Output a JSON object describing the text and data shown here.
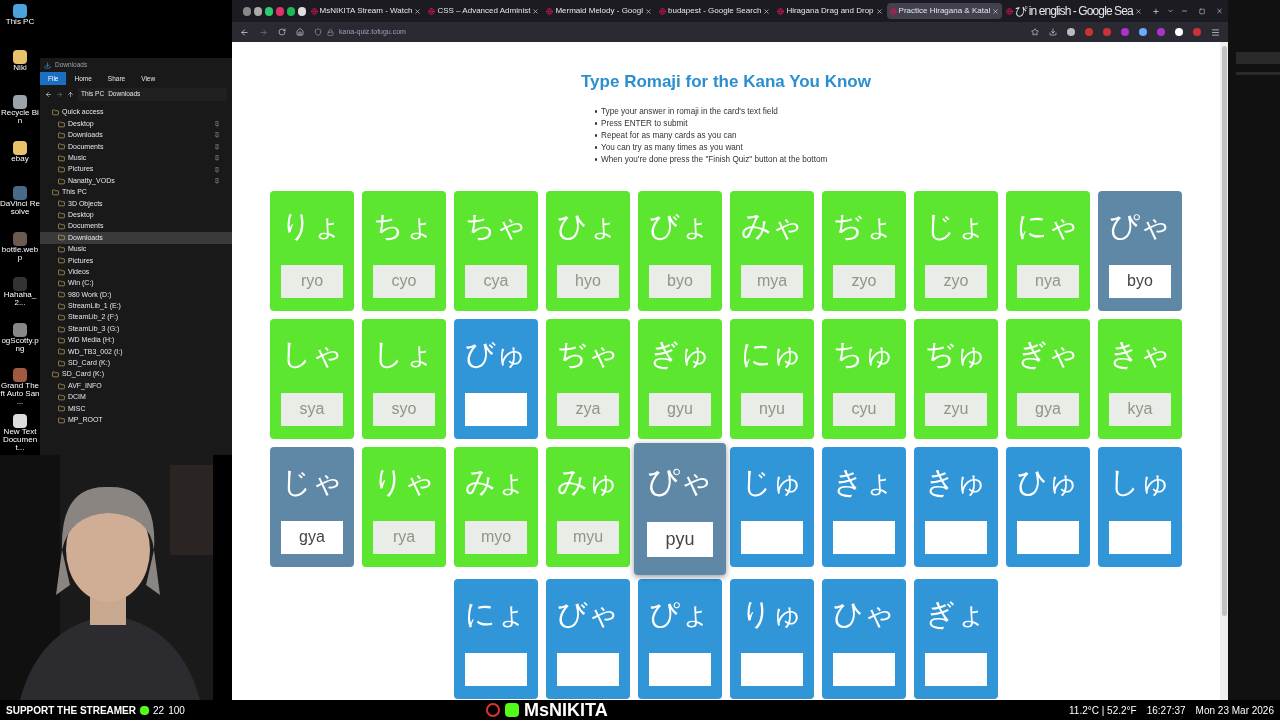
{
  "desktop": {
    "icons": [
      {
        "label": "This PC"
      },
      {
        "label": "Niki"
      },
      {
        "label": "Recycle Bin"
      },
      {
        "label": "ebay"
      },
      {
        "label": "DaVinci Resolve"
      },
      {
        "label": "bottle.webp"
      },
      {
        "label": "Hahaha_2..."
      },
      {
        "label": "ogScotty.png"
      },
      {
        "label": "Grand Theft Auto San ..."
      },
      {
        "label": "New Text Document..."
      }
    ]
  },
  "explorer": {
    "title": "Downloads",
    "ribbon_tabs": [
      {
        "label": "File",
        "selected": true
      },
      {
        "label": "Home",
        "selected": false
      },
      {
        "label": "Share",
        "selected": false
      },
      {
        "label": "View",
        "selected": false
      }
    ],
    "breadcrumb": [
      "This PC",
      "Downloads"
    ],
    "tree": [
      {
        "label": "Quick access",
        "selected": false,
        "children": [
          {
            "label": "Desktop",
            "selected": false,
            "pinned": true
          },
          {
            "label": "Downloads",
            "selected": false,
            "pinned": true
          },
          {
            "label": "Documents",
            "selected": false,
            "pinned": true
          },
          {
            "label": "Music",
            "selected": false,
            "pinned": true
          },
          {
            "label": "Pictures",
            "selected": false,
            "pinned": true
          },
          {
            "label": "Nanatty_VODs",
            "selected": false,
            "pinned": true
          }
        ]
      },
      {
        "label": "This PC",
        "selected": false,
        "children": [
          {
            "label": "3D Objects",
            "selected": false,
            "pinned": false
          },
          {
            "label": "Desktop",
            "selected": false,
            "pinned": false
          },
          {
            "label": "Documents",
            "selected": false,
            "pinned": false
          },
          {
            "label": "Downloads",
            "selected": true,
            "pinned": false
          },
          {
            "label": "Music",
            "selected": false,
            "pinned": false
          },
          {
            "label": "Pictures",
            "selected": false,
            "pinned": false
          },
          {
            "label": "Videos",
            "selected": false,
            "pinned": false
          },
          {
            "label": "Win (C:)",
            "selected": false,
            "pinned": false
          },
          {
            "label": "980 Work (D:)",
            "selected": false,
            "pinned": false
          },
          {
            "label": "StreamLib_1 (E:)",
            "selected": false,
            "pinned": false
          },
          {
            "label": "SteamLib_2 (F:)",
            "selected": false,
            "pinned": false
          },
          {
            "label": "SteamLib_3 (G:)",
            "selected": false,
            "pinned": false
          },
          {
            "label": "WD Media (H:)",
            "selected": false,
            "pinned": false
          },
          {
            "label": "WD_TB3_002 (I:)",
            "selected": false,
            "pinned": false
          },
          {
            "label": "SD_Card (K:)",
            "selected": false,
            "pinned": false
          }
        ]
      },
      {
        "label": "SD_Card (K:)",
        "selected": false,
        "children": [
          {
            "label": "AVF_INFO",
            "selected": false,
            "pinned": false
          },
          {
            "label": "DCIM",
            "selected": false,
            "pinned": false
          },
          {
            "label": "MISC",
            "selected": false,
            "pinned": false
          },
          {
            "label": "MP_ROOT",
            "selected": false,
            "pinned": false
          }
        ]
      }
    ]
  },
  "browser": {
    "tabs": [
      {
        "label": "MsNIKITA Stream - Watch",
        "selected": false
      },
      {
        "label": "CSS – Advanced Administ",
        "selected": false
      },
      {
        "label": "Mermaid Melody - Googl",
        "selected": false
      },
      {
        "label": "budapest - Google Search",
        "selected": false
      },
      {
        "label": "Hiragana Drag and Drop",
        "selected": false
      },
      {
        "label": "Practice Hiragana & Katal",
        "selected": true
      },
      {
        "label": "ぴ in english - Google Sea",
        "selected": false
      }
    ],
    "url": "kana-quiz.tofugu.com"
  },
  "page": {
    "title": "Type Romaji for the Kana You Know",
    "instructions": [
      "Type your answer in romaji in the card's text field",
      "Press ENTER to submit",
      "Repeat for as many cards as you can",
      "You can try as many times as you want",
      "When you're done press the \"Finish Quiz\" button at the bottom"
    ],
    "cards": [
      {
        "kana": "りょ",
        "kind": "correct",
        "answer": "ryo",
        "focused": false
      },
      {
        "kana": "ちょ",
        "kind": "correct",
        "answer": "cyo",
        "focused": false
      },
      {
        "kana": "ちゃ",
        "kind": "correct",
        "answer": "cya",
        "focused": false
      },
      {
        "kana": "ひょ",
        "kind": "correct",
        "answer": "hyo",
        "focused": false
      },
      {
        "kana": "びょ",
        "kind": "correct",
        "answer": "byo",
        "focused": false
      },
      {
        "kana": "みゃ",
        "kind": "correct",
        "answer": "mya",
        "focused": false
      },
      {
        "kana": "ぢょ",
        "kind": "correct",
        "answer": "zyo",
        "focused": false
      },
      {
        "kana": "じょ",
        "kind": "correct",
        "answer": "zyo",
        "focused": false
      },
      {
        "kana": "にゃ",
        "kind": "correct",
        "answer": "nya",
        "focused": false
      },
      {
        "kana": "ぴゃ",
        "kind": "wrong",
        "answer": "byo",
        "focused": false
      },
      {
        "kana": "しゃ",
        "kind": "correct",
        "answer": "sya",
        "focused": false
      },
      {
        "kana": "しょ",
        "kind": "correct",
        "answer": "syo",
        "focused": false
      },
      {
        "kana": "びゅ",
        "kind": "open",
        "focused": false
      },
      {
        "kana": "ぢゃ",
        "kind": "correct",
        "answer": "zya",
        "focused": false
      },
      {
        "kana": "ぎゅ",
        "kind": "correct",
        "answer": "gyu",
        "focused": false
      },
      {
        "kana": "にゅ",
        "kind": "correct",
        "answer": "nyu",
        "focused": false
      },
      {
        "kana": "ちゅ",
        "kind": "correct",
        "answer": "cyu",
        "focused": false
      },
      {
        "kana": "ぢゅ",
        "kind": "correct",
        "answer": "zyu",
        "focused": false
      },
      {
        "kana": "ぎゃ",
        "kind": "correct",
        "answer": "gya",
        "focused": false
      },
      {
        "kana": "きゃ",
        "kind": "correct",
        "answer": "kya",
        "focused": false
      },
      {
        "kana": "じゃ",
        "kind": "wrong",
        "answer": "gya",
        "focused": false
      },
      {
        "kana": "りゃ",
        "kind": "correct",
        "answer": "rya",
        "focused": false
      },
      {
        "kana": "みょ",
        "kind": "correct",
        "answer": "myo",
        "focused": false
      },
      {
        "kana": "みゅ",
        "kind": "correct",
        "answer": "myu",
        "focused": false
      },
      {
        "kana": "ぴゃ",
        "kind": "wrong",
        "answer": "pyu",
        "focused": true
      },
      {
        "kana": "じゅ",
        "kind": "open",
        "focused": false
      },
      {
        "kana": "きょ",
        "kind": "open",
        "focused": false
      },
      {
        "kana": "きゅ",
        "kind": "open",
        "focused": false
      },
      {
        "kana": "ひゅ",
        "kind": "open",
        "focused": false
      },
      {
        "kana": "しゅ",
        "kind": "open",
        "focused": false
      },
      {
        "kana": "にょ",
        "kind": "open",
        "focused": false
      },
      {
        "kana": "びゃ",
        "kind": "open",
        "focused": false
      },
      {
        "kana": "ぴょ",
        "kind": "open",
        "focused": false
      },
      {
        "kana": "りゅ",
        "kind": "open",
        "focused": false
      },
      {
        "kana": "ひゃ",
        "kind": "open",
        "focused": false
      },
      {
        "kana": "ぎょ",
        "kind": "open",
        "focused": false
      }
    ]
  },
  "stream_bar": {
    "support": "SUPPORT THE STREAMER",
    "count_1": "22",
    "count_2": "100",
    "channel": "MsNIKITA",
    "weather": "11.2°C | 52.2°F",
    "time": "16:27:37",
    "date": "Mon 23 Mar 2026"
  }
}
